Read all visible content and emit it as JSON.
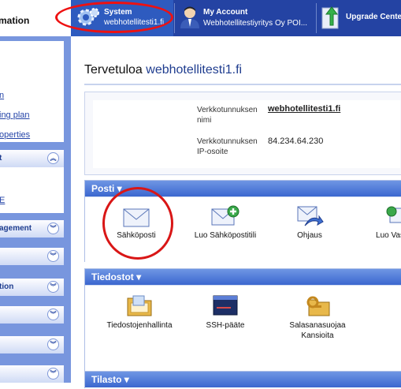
{
  "brand": {
    "text": "mation"
  },
  "tabs": [
    {
      "title": "System",
      "subtitle": "webhotellitesti1.fi"
    },
    {
      "title": "My Account",
      "subtitle": "Webhotellitestiyritys Oy POI..."
    },
    {
      "title": "Upgrade Cente",
      "subtitle": ""
    }
  ],
  "sidebar": {
    "links": [
      "n",
      "ing plan",
      "operties"
    ],
    "section_head": "t",
    "section_link": "E",
    "collapsed": [
      "agement",
      "",
      "tion",
      "",
      "",
      ""
    ]
  },
  "main": {
    "welcome_prefix": "Tervetuloa ",
    "welcome_domain": "webhotellitesti1.fi",
    "info": {
      "name_label": "Verkkotunnuksen nimi",
      "name_value": "webhotellitesti1.fi",
      "ip_label": "Verkkotunnuksen IP-osoite",
      "ip_value": "84.234.64.230"
    },
    "sections": {
      "posti": {
        "title": "Posti ▾",
        "items": [
          "Sähköposti",
          "Luo Sähköpostitili",
          "Ohjaus",
          "Luo Vas"
        ]
      },
      "tiedostot": {
        "title": "Tiedostot ▾",
        "items": [
          "Tiedostojenhallinta",
          "SSH-pääte",
          "Salasanasuojaa Kansioita"
        ]
      },
      "tilasto": {
        "title": "Tilasto ▾"
      }
    }
  },
  "colors": {
    "topbar": "#2443a3",
    "sidebar": "#7896de",
    "panel_head": "#3b67cf",
    "highlight": "#e11111"
  }
}
